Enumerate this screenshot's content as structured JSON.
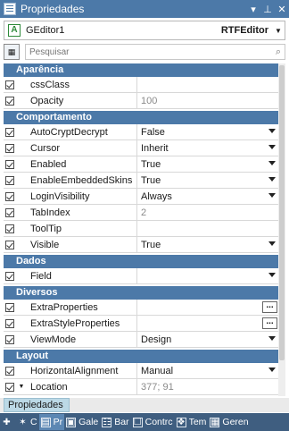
{
  "window": {
    "title": "Propriedades",
    "pin_glyph": "⊥",
    "close_glyph": "✕",
    "menu_glyph": "▾"
  },
  "object_selector": {
    "name": "GEditor1",
    "type": "RTFEditor",
    "icon_letter": "A"
  },
  "search": {
    "placeholder": "Pesquisar"
  },
  "groups": [
    {
      "label": "Aparência",
      "rows": [
        {
          "name": "cssClass",
          "value": "",
          "checked": true,
          "dropdown": false,
          "ellipsis": false,
          "dim": false
        },
        {
          "name": "Opacity",
          "value": "100",
          "checked": true,
          "dropdown": false,
          "ellipsis": false,
          "dim": true
        }
      ]
    },
    {
      "label": "Comportamento",
      "rows": [
        {
          "name": "AutoCryptDecrypt",
          "value": "False",
          "checked": true,
          "dropdown": true,
          "ellipsis": false,
          "dim": false
        },
        {
          "name": "Cursor",
          "value": "Inherit",
          "checked": true,
          "dropdown": true,
          "ellipsis": false,
          "dim": false
        },
        {
          "name": "Enabled",
          "value": "True",
          "checked": true,
          "dropdown": true,
          "ellipsis": false,
          "dim": false
        },
        {
          "name": "EnableEmbeddedSkins",
          "value": "True",
          "checked": true,
          "dropdown": true,
          "ellipsis": false,
          "dim": false
        },
        {
          "name": "LoginVisibility",
          "value": "Always",
          "checked": true,
          "dropdown": true,
          "ellipsis": false,
          "dim": false
        },
        {
          "name": "TabIndex",
          "value": "2",
          "checked": true,
          "dropdown": false,
          "ellipsis": false,
          "dim": true
        },
        {
          "name": "ToolTip",
          "value": "",
          "checked": true,
          "dropdown": false,
          "ellipsis": false,
          "dim": false
        },
        {
          "name": "Visible",
          "value": "True",
          "checked": true,
          "dropdown": true,
          "ellipsis": false,
          "dim": false
        }
      ]
    },
    {
      "label": "Dados",
      "rows": [
        {
          "name": "Field",
          "value": "",
          "checked": true,
          "dropdown": true,
          "ellipsis": false,
          "dim": false
        }
      ]
    },
    {
      "label": "Diversos",
      "rows": [
        {
          "name": "ExtraProperties",
          "value": "",
          "checked": true,
          "dropdown": false,
          "ellipsis": true,
          "dim": false
        },
        {
          "name": "ExtraStyleProperties",
          "value": "",
          "checked": true,
          "dropdown": false,
          "ellipsis": true,
          "dim": false
        },
        {
          "name": "ViewMode",
          "value": "Design",
          "checked": true,
          "dropdown": true,
          "ellipsis": false,
          "dim": false
        }
      ]
    },
    {
      "label": "Layout",
      "rows": [
        {
          "name": "HorizontalAlignment",
          "value": "Manual",
          "checked": true,
          "dropdown": true,
          "ellipsis": false,
          "dim": false
        },
        {
          "name": "Location",
          "value": "377; 91",
          "checked": true,
          "dropdown": false,
          "ellipsis": false,
          "dim": true,
          "expandable": true
        }
      ]
    }
  ],
  "bottom_tab": {
    "label": "Propiedades"
  },
  "toolbar": [
    {
      "label": "",
      "icon": "✚"
    },
    {
      "label": "C",
      "icon": "✶"
    },
    {
      "label": "Pr",
      "icon": "▤",
      "active": true
    },
    {
      "label": "Gale",
      "icon": "▣"
    },
    {
      "label": "Bar",
      "icon": "☷"
    },
    {
      "label": "Contrc",
      "icon": "☐"
    },
    {
      "label": "Tem",
      "icon": "❖"
    },
    {
      "label": "Geren",
      "icon": "▦"
    }
  ]
}
